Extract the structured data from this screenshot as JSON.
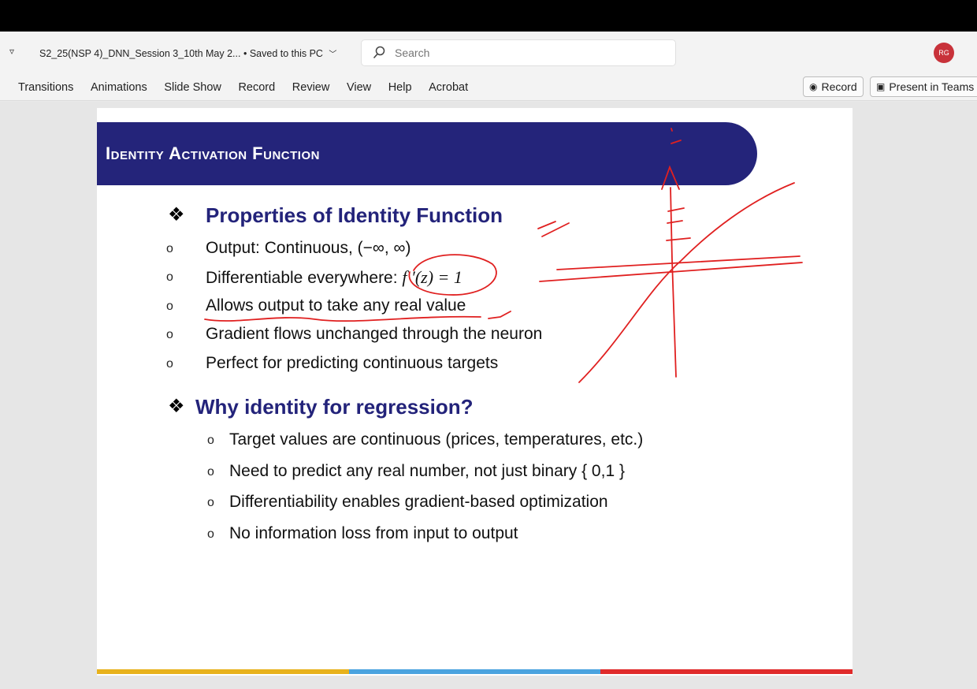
{
  "titlebar": {
    "qat_icon": "customize-qat-icon",
    "doc_title": "S2_25(NSP 4)_DNN_Session 3_10th May 2...",
    "separator": "•",
    "save_status": "Saved to this PC",
    "search_placeholder": "Search",
    "avatar_initials": "RG"
  },
  "ribbon": {
    "tabs": [
      "Transitions",
      "Animations",
      "Slide Show",
      "Record",
      "Review",
      "View",
      "Help",
      "Acrobat"
    ],
    "record_button": "Record",
    "present_button": "Present in Teams"
  },
  "slide": {
    "title": "Identity Activation Function",
    "section1": {
      "heading": "Properties of Identity Function",
      "bullets": [
        "Output: Continuous, (−∞, ∞)",
        "Differentiable everywhere:",
        "Allows output to take any real value",
        "Gradient flows unchanged through the neuron",
        "Perfect for predicting continuous targets"
      ],
      "derivative": "f ′(z) = 1"
    },
    "section2": {
      "heading": "Why identity for regression?",
      "bullets": [
        "Target values are continuous (prices, temperatures, etc.)",
        "Need to predict any real number, not just binary { 0,1 }",
        "Differentiability enables gradient-based optimization",
        "No information loss from input to output"
      ]
    },
    "bottom_bar_colors": [
      "#e8b21c",
      "#4aa3df",
      "#e02b2b"
    ]
  },
  "colors": {
    "header_band": "#24247a",
    "heading_text": "#23237a",
    "ink_annotation": "#e02020"
  }
}
